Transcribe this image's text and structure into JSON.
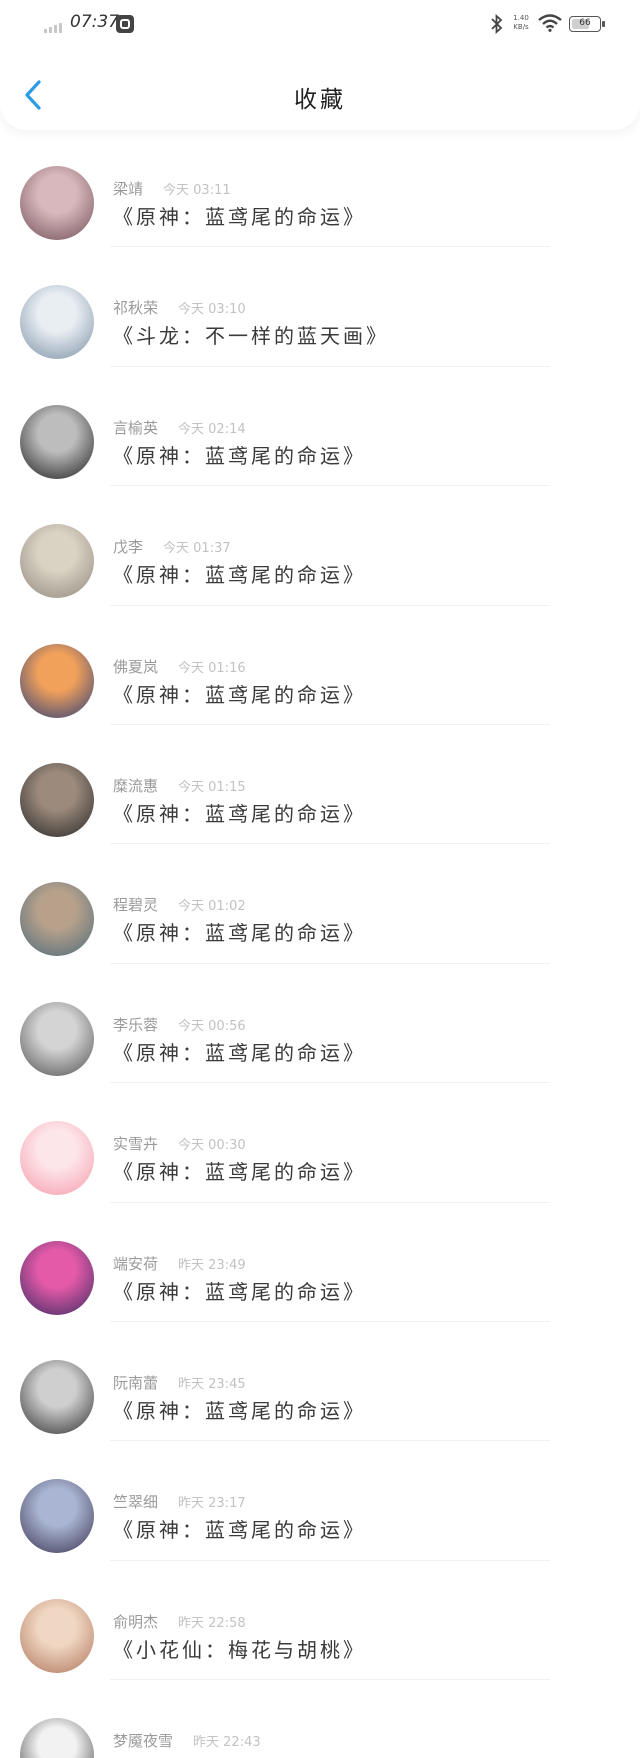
{
  "status_bar": {
    "time": "07:37",
    "net_speed_value": "1.40",
    "net_speed_unit": "KB/s",
    "battery": "66",
    "battery_level": 0.66
  },
  "header": {
    "title": "收藏",
    "back_icon": "chevron-left-icon",
    "accent_color": "#2b9be6"
  },
  "favorites": [
    {
      "name": "梁靖",
      "time": "今天 03:11",
      "book": "《原神：蓝鸢尾的命运》"
    },
    {
      "name": "祁秋荣",
      "time": "今天 03:10",
      "book": "《斗龙：不一样的蓝天画》"
    },
    {
      "name": "言榆英",
      "time": "今天 02:14",
      "book": "《原神：蓝鸢尾的命运》"
    },
    {
      "name": "戊李",
      "time": "今天 01:37",
      "book": "《原神：蓝鸢尾的命运》"
    },
    {
      "name": "佛夏岚",
      "time": "今天 01:16",
      "book": "《原神：蓝鸢尾的命运》"
    },
    {
      "name": "糜流惠",
      "time": "今天 01:15",
      "book": "《原神：蓝鸢尾的命运》"
    },
    {
      "name": "程碧灵",
      "time": "今天 01:02",
      "book": "《原神：蓝鸢尾的命运》"
    },
    {
      "name": "李乐蓉",
      "time": "今天 00:56",
      "book": "《原神：蓝鸢尾的命运》"
    },
    {
      "name": "实雪卉",
      "time": "今天 00:30",
      "book": "《原神：蓝鸢尾的命运》"
    },
    {
      "name": "端安荷",
      "time": "昨天 23:49",
      "book": "《原神：蓝鸢尾的命运》"
    },
    {
      "name": "阮南蕾",
      "time": "昨天 23:45",
      "book": "《原神：蓝鸢尾的命运》"
    },
    {
      "name": "竺翠细",
      "time": "昨天 23:17",
      "book": "《原神：蓝鸢尾的命运》"
    },
    {
      "name": "俞明杰",
      "time": "昨天 22:58",
      "book": "《小花仙：梅花与胡桃》"
    },
    {
      "name": "梦魇夜雪",
      "time": "昨天 22:43",
      "book": ""
    }
  ],
  "avatar_colors": [
    [
      "#d9b8bd",
      "#6f4e56"
    ],
    [
      "#e9eef3",
      "#7a8fa3"
    ],
    [
      "#bdbdbd",
      "#1c1c1c"
    ],
    [
      "#dad3c4",
      "#8f887c"
    ],
    [
      "#f2a15b",
      "#2c3e78"
    ],
    [
      "#9c8a7c",
      "#262626"
    ],
    [
      "#b7a18b",
      "#4d6b7a"
    ],
    [
      "#d4d4d4",
      "#505050"
    ],
    [
      "#fde6ea",
      "#f59aa9"
    ],
    [
      "#e45aa8",
      "#3a2b62"
    ],
    [
      "#cfcfcf",
      "#2e2e2e"
    ],
    [
      "#a9b5d2",
      "#3b3450"
    ],
    [
      "#f0d7c3",
      "#b0745a"
    ],
    [
      "#f2f2f2",
      "#3a3a3a"
    ]
  ]
}
